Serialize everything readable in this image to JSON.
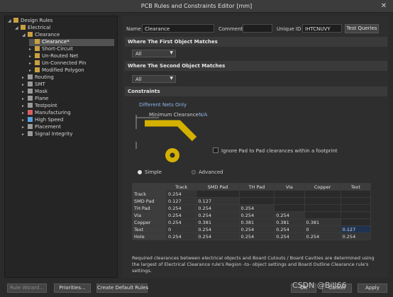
{
  "window": {
    "title": "PCB Rules and Constraints Editor [mm]",
    "close": "✕"
  },
  "tree": [
    {
      "label": "Design Rules",
      "exp": "◢",
      "icon": "#c8a040"
    },
    {
      "label": "Electrical",
      "exp": "◢",
      "icon": "#c8a040"
    },
    {
      "label": "Clearance",
      "exp": "◢",
      "icon": "#c8a040"
    },
    {
      "label": "Clearance*",
      "exp": "",
      "icon": "#c8a040"
    },
    {
      "label": "Short-Circuit",
      "exp": "▸",
      "icon": "#c8a040"
    },
    {
      "label": "Un-Routed Net",
      "exp": "▸",
      "icon": "#c8a040"
    },
    {
      "label": "Un-Connected Pin",
      "exp": "▸",
      "icon": "#c8a040"
    },
    {
      "label": "Modified Polygon",
      "exp": "▸",
      "icon": "#c8a040"
    },
    {
      "label": "Routing",
      "exp": "▸",
      "icon": "#9a9a9a"
    },
    {
      "label": "SMT",
      "exp": "▸",
      "icon": "#9a9a9a"
    },
    {
      "label": "Mask",
      "exp": "▸",
      "icon": "#9a9a9a"
    },
    {
      "label": "Plane",
      "exp": "▸",
      "icon": "#9a9a9a"
    },
    {
      "label": "Testpoint",
      "exp": "▸",
      "icon": "#9a9a9a"
    },
    {
      "label": "Manufacturing",
      "exp": "▸",
      "icon": "#d86060"
    },
    {
      "label": "High Speed",
      "exp": "▸",
      "icon": "#5aa0e0"
    },
    {
      "label": "Placement",
      "exp": "▸",
      "icon": "#9a9a9a"
    },
    {
      "label": "Signal Integrity",
      "exp": "▸",
      "icon": "#9a9a9a"
    }
  ],
  "rule": {
    "name_label": "Name",
    "name_value": "Clearance",
    "comment_label": "Comment",
    "comment_value": "",
    "uid_label": "Unique ID",
    "uid_value": "IHTCNUVY",
    "test_queries": "Test Queries"
  },
  "first_match": {
    "header": "Where The First Object Matches",
    "value": "All"
  },
  "second_match": {
    "header": "Where The Second Object Matches",
    "value": "All"
  },
  "constraints": {
    "header": "Constraints",
    "different_nets": "Different Nets Only",
    "min_clearance_label": "Minimum Clearance",
    "min_clearance_value": "N/A",
    "ignore_pad": "Ignore Pad to Pad clearances within a footprint",
    "simple": "Simple",
    "advanced": "Advanced"
  },
  "matrix": {
    "columns": [
      "Track",
      "SMD Pad",
      "TH Pad",
      "Via",
      "Copper",
      "Text"
    ],
    "rows": [
      {
        "name": "Track",
        "cells": [
          "0.254",
          "",
          "",
          "",
          "",
          ""
        ]
      },
      {
        "name": "SMD Pad",
        "cells": [
          "0.127",
          "0.127",
          "",
          "",
          "",
          ""
        ]
      },
      {
        "name": "TH Pad",
        "cells": [
          "0.254",
          "0.254",
          "0.254",
          "",
          "",
          ""
        ]
      },
      {
        "name": "Via",
        "cells": [
          "0.254",
          "0.254",
          "0.254",
          "0.254",
          "",
          ""
        ]
      },
      {
        "name": "Copper",
        "cells": [
          "0.254",
          "0.381",
          "0.381",
          "0.381",
          "0.381",
          ""
        ]
      },
      {
        "name": "Text",
        "cells": [
          "0",
          "0.254",
          "0.254",
          "0.254",
          "0",
          "0.127"
        ]
      },
      {
        "name": "Hole",
        "cells": [
          "0.254",
          "0.254",
          "0.254",
          "0.254",
          "0.254",
          "0.254"
        ]
      }
    ]
  },
  "description": "Required clearances between electrical objects and Board Cutouts / Board Cavities are determined using the largest of Electrical Clearance rule's Region -to- object settings and Board Outline Clearance rule's settings.",
  "bottom": {
    "rule_wizard": "Rule Wizard...",
    "priorities": "Priorities...",
    "create_default": "Create Default Rules",
    "ok": "OK",
    "cancel": "Cancel",
    "apply": "Apply",
    "watermark": "CSDN @Bill66"
  },
  "colors": {
    "accent": "#d4b000",
    "selection": "#1f3350"
  }
}
